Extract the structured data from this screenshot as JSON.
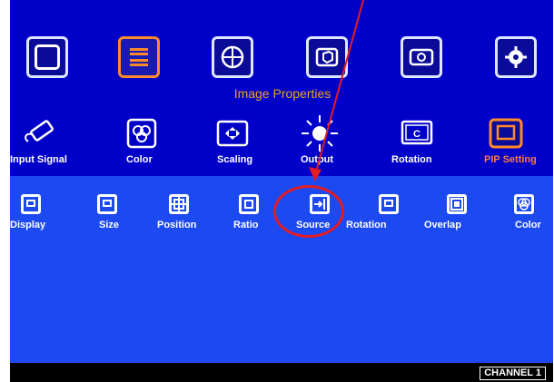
{
  "main_menu": {
    "title": "Image Properties",
    "icons": [
      {
        "name": "palette-icon",
        "selected": false
      },
      {
        "name": "image-properties-icon",
        "selected": true
      },
      {
        "name": "globe-icon",
        "selected": false
      },
      {
        "name": "cube-icon",
        "selected": false
      },
      {
        "name": "display-icon",
        "selected": false
      },
      {
        "name": "gear-icon",
        "selected": false
      }
    ]
  },
  "sub_menu": {
    "items": [
      {
        "label": "Input Signal",
        "icon": "usb-cable-icon"
      },
      {
        "label": "Color",
        "icon": "color-icon"
      },
      {
        "label": "Scaling",
        "icon": "scaling-icon"
      },
      {
        "label": "Output",
        "icon": "sun-icon"
      },
      {
        "label": "Rotation",
        "icon": "rotation-icon"
      },
      {
        "label": "PIP Setting",
        "icon": "pip-setting-icon",
        "active": true
      }
    ]
  },
  "pip_menu": {
    "items": [
      {
        "label": "Display",
        "icon": "display-icon"
      },
      {
        "label": "Size",
        "icon": "size-icon"
      },
      {
        "label": "Position",
        "icon": "position-icon"
      },
      {
        "label": "Ratio",
        "icon": "ratio-icon"
      },
      {
        "label": "Source",
        "icon": "source-icon",
        "highlighted": true
      },
      {
        "label": "Rotation",
        "icon": "rotation-icon"
      },
      {
        "label": "Overlap",
        "icon": "overlap-icon"
      },
      {
        "label": "Color",
        "icon": "color-icon"
      }
    ]
  },
  "footer": {
    "channel": "CHANNEL 1"
  },
  "colors": {
    "top_background": "#0000c8",
    "bottom_background": "#1c49f0",
    "accent_orange": "#ff8a2a",
    "annotation_red": "#e31b23"
  }
}
